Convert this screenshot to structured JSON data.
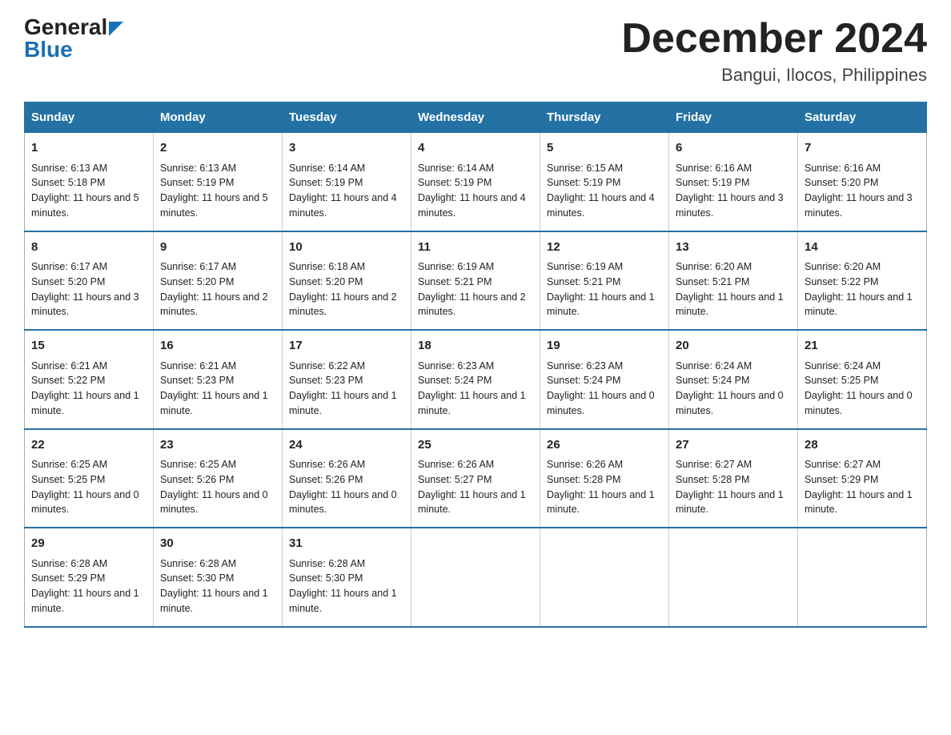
{
  "logo": {
    "general": "General",
    "blue": "Blue"
  },
  "title": "December 2024",
  "location": "Bangui, Ilocos, Philippines",
  "days_header": [
    "Sunday",
    "Monday",
    "Tuesday",
    "Wednesday",
    "Thursday",
    "Friday",
    "Saturday"
  ],
  "weeks": [
    [
      {
        "num": "1",
        "sunrise": "6:13 AM",
        "sunset": "5:18 PM",
        "daylight": "11 hours and 5 minutes."
      },
      {
        "num": "2",
        "sunrise": "6:13 AM",
        "sunset": "5:19 PM",
        "daylight": "11 hours and 5 minutes."
      },
      {
        "num": "3",
        "sunrise": "6:14 AM",
        "sunset": "5:19 PM",
        "daylight": "11 hours and 4 minutes."
      },
      {
        "num": "4",
        "sunrise": "6:14 AM",
        "sunset": "5:19 PM",
        "daylight": "11 hours and 4 minutes."
      },
      {
        "num": "5",
        "sunrise": "6:15 AM",
        "sunset": "5:19 PM",
        "daylight": "11 hours and 4 minutes."
      },
      {
        "num": "6",
        "sunrise": "6:16 AM",
        "sunset": "5:19 PM",
        "daylight": "11 hours and 3 minutes."
      },
      {
        "num": "7",
        "sunrise": "6:16 AM",
        "sunset": "5:20 PM",
        "daylight": "11 hours and 3 minutes."
      }
    ],
    [
      {
        "num": "8",
        "sunrise": "6:17 AM",
        "sunset": "5:20 PM",
        "daylight": "11 hours and 3 minutes."
      },
      {
        "num": "9",
        "sunrise": "6:17 AM",
        "sunset": "5:20 PM",
        "daylight": "11 hours and 2 minutes."
      },
      {
        "num": "10",
        "sunrise": "6:18 AM",
        "sunset": "5:20 PM",
        "daylight": "11 hours and 2 minutes."
      },
      {
        "num": "11",
        "sunrise": "6:19 AM",
        "sunset": "5:21 PM",
        "daylight": "11 hours and 2 minutes."
      },
      {
        "num": "12",
        "sunrise": "6:19 AM",
        "sunset": "5:21 PM",
        "daylight": "11 hours and 1 minute."
      },
      {
        "num": "13",
        "sunrise": "6:20 AM",
        "sunset": "5:21 PM",
        "daylight": "11 hours and 1 minute."
      },
      {
        "num": "14",
        "sunrise": "6:20 AM",
        "sunset": "5:22 PM",
        "daylight": "11 hours and 1 minute."
      }
    ],
    [
      {
        "num": "15",
        "sunrise": "6:21 AM",
        "sunset": "5:22 PM",
        "daylight": "11 hours and 1 minute."
      },
      {
        "num": "16",
        "sunrise": "6:21 AM",
        "sunset": "5:23 PM",
        "daylight": "11 hours and 1 minute."
      },
      {
        "num": "17",
        "sunrise": "6:22 AM",
        "sunset": "5:23 PM",
        "daylight": "11 hours and 1 minute."
      },
      {
        "num": "18",
        "sunrise": "6:23 AM",
        "sunset": "5:24 PM",
        "daylight": "11 hours and 1 minute."
      },
      {
        "num": "19",
        "sunrise": "6:23 AM",
        "sunset": "5:24 PM",
        "daylight": "11 hours and 0 minutes."
      },
      {
        "num": "20",
        "sunrise": "6:24 AM",
        "sunset": "5:24 PM",
        "daylight": "11 hours and 0 minutes."
      },
      {
        "num": "21",
        "sunrise": "6:24 AM",
        "sunset": "5:25 PM",
        "daylight": "11 hours and 0 minutes."
      }
    ],
    [
      {
        "num": "22",
        "sunrise": "6:25 AM",
        "sunset": "5:25 PM",
        "daylight": "11 hours and 0 minutes."
      },
      {
        "num": "23",
        "sunrise": "6:25 AM",
        "sunset": "5:26 PM",
        "daylight": "11 hours and 0 minutes."
      },
      {
        "num": "24",
        "sunrise": "6:26 AM",
        "sunset": "5:26 PM",
        "daylight": "11 hours and 0 minutes."
      },
      {
        "num": "25",
        "sunrise": "6:26 AM",
        "sunset": "5:27 PM",
        "daylight": "11 hours and 1 minute."
      },
      {
        "num": "26",
        "sunrise": "6:26 AM",
        "sunset": "5:28 PM",
        "daylight": "11 hours and 1 minute."
      },
      {
        "num": "27",
        "sunrise": "6:27 AM",
        "sunset": "5:28 PM",
        "daylight": "11 hours and 1 minute."
      },
      {
        "num": "28",
        "sunrise": "6:27 AM",
        "sunset": "5:29 PM",
        "daylight": "11 hours and 1 minute."
      }
    ],
    [
      {
        "num": "29",
        "sunrise": "6:28 AM",
        "sunset": "5:29 PM",
        "daylight": "11 hours and 1 minute."
      },
      {
        "num": "30",
        "sunrise": "6:28 AM",
        "sunset": "5:30 PM",
        "daylight": "11 hours and 1 minute."
      },
      {
        "num": "31",
        "sunrise": "6:28 AM",
        "sunset": "5:30 PM",
        "daylight": "11 hours and 1 minute."
      },
      {
        "num": "",
        "sunrise": "",
        "sunset": "",
        "daylight": ""
      },
      {
        "num": "",
        "sunrise": "",
        "sunset": "",
        "daylight": ""
      },
      {
        "num": "",
        "sunrise": "",
        "sunset": "",
        "daylight": ""
      },
      {
        "num": "",
        "sunrise": "",
        "sunset": "",
        "daylight": ""
      }
    ]
  ]
}
